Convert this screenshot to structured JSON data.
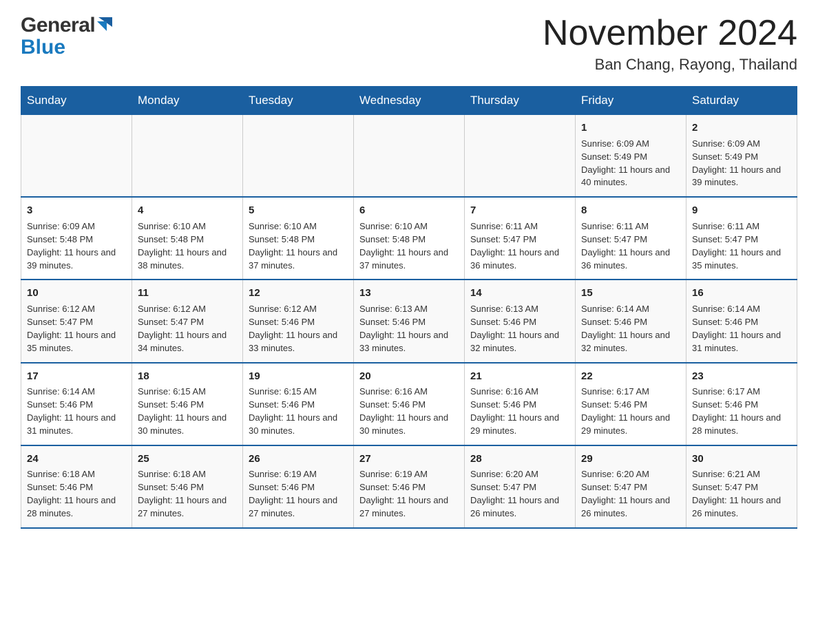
{
  "header": {
    "logo_general": "General",
    "logo_blue": "Blue",
    "title": "November 2024",
    "subtitle": "Ban Chang, Rayong, Thailand"
  },
  "days_of_week": [
    "Sunday",
    "Monday",
    "Tuesday",
    "Wednesday",
    "Thursday",
    "Friday",
    "Saturday"
  ],
  "weeks": [
    {
      "cells": [
        {
          "day": "",
          "info": ""
        },
        {
          "day": "",
          "info": ""
        },
        {
          "day": "",
          "info": ""
        },
        {
          "day": "",
          "info": ""
        },
        {
          "day": "",
          "info": ""
        },
        {
          "day": "1",
          "info": "Sunrise: 6:09 AM\nSunset: 5:49 PM\nDaylight: 11 hours and 40 minutes."
        },
        {
          "day": "2",
          "info": "Sunrise: 6:09 AM\nSunset: 5:49 PM\nDaylight: 11 hours and 39 minutes."
        }
      ]
    },
    {
      "cells": [
        {
          "day": "3",
          "info": "Sunrise: 6:09 AM\nSunset: 5:48 PM\nDaylight: 11 hours and 39 minutes."
        },
        {
          "day": "4",
          "info": "Sunrise: 6:10 AM\nSunset: 5:48 PM\nDaylight: 11 hours and 38 minutes."
        },
        {
          "day": "5",
          "info": "Sunrise: 6:10 AM\nSunset: 5:48 PM\nDaylight: 11 hours and 37 minutes."
        },
        {
          "day": "6",
          "info": "Sunrise: 6:10 AM\nSunset: 5:48 PM\nDaylight: 11 hours and 37 minutes."
        },
        {
          "day": "7",
          "info": "Sunrise: 6:11 AM\nSunset: 5:47 PM\nDaylight: 11 hours and 36 minutes."
        },
        {
          "day": "8",
          "info": "Sunrise: 6:11 AM\nSunset: 5:47 PM\nDaylight: 11 hours and 36 minutes."
        },
        {
          "day": "9",
          "info": "Sunrise: 6:11 AM\nSunset: 5:47 PM\nDaylight: 11 hours and 35 minutes."
        }
      ]
    },
    {
      "cells": [
        {
          "day": "10",
          "info": "Sunrise: 6:12 AM\nSunset: 5:47 PM\nDaylight: 11 hours and 35 minutes."
        },
        {
          "day": "11",
          "info": "Sunrise: 6:12 AM\nSunset: 5:47 PM\nDaylight: 11 hours and 34 minutes."
        },
        {
          "day": "12",
          "info": "Sunrise: 6:12 AM\nSunset: 5:46 PM\nDaylight: 11 hours and 33 minutes."
        },
        {
          "day": "13",
          "info": "Sunrise: 6:13 AM\nSunset: 5:46 PM\nDaylight: 11 hours and 33 minutes."
        },
        {
          "day": "14",
          "info": "Sunrise: 6:13 AM\nSunset: 5:46 PM\nDaylight: 11 hours and 32 minutes."
        },
        {
          "day": "15",
          "info": "Sunrise: 6:14 AM\nSunset: 5:46 PM\nDaylight: 11 hours and 32 minutes."
        },
        {
          "day": "16",
          "info": "Sunrise: 6:14 AM\nSunset: 5:46 PM\nDaylight: 11 hours and 31 minutes."
        }
      ]
    },
    {
      "cells": [
        {
          "day": "17",
          "info": "Sunrise: 6:14 AM\nSunset: 5:46 PM\nDaylight: 11 hours and 31 minutes."
        },
        {
          "day": "18",
          "info": "Sunrise: 6:15 AM\nSunset: 5:46 PM\nDaylight: 11 hours and 30 minutes."
        },
        {
          "day": "19",
          "info": "Sunrise: 6:15 AM\nSunset: 5:46 PM\nDaylight: 11 hours and 30 minutes."
        },
        {
          "day": "20",
          "info": "Sunrise: 6:16 AM\nSunset: 5:46 PM\nDaylight: 11 hours and 30 minutes."
        },
        {
          "day": "21",
          "info": "Sunrise: 6:16 AM\nSunset: 5:46 PM\nDaylight: 11 hours and 29 minutes."
        },
        {
          "day": "22",
          "info": "Sunrise: 6:17 AM\nSunset: 5:46 PM\nDaylight: 11 hours and 29 minutes."
        },
        {
          "day": "23",
          "info": "Sunrise: 6:17 AM\nSunset: 5:46 PM\nDaylight: 11 hours and 28 minutes."
        }
      ]
    },
    {
      "cells": [
        {
          "day": "24",
          "info": "Sunrise: 6:18 AM\nSunset: 5:46 PM\nDaylight: 11 hours and 28 minutes."
        },
        {
          "day": "25",
          "info": "Sunrise: 6:18 AM\nSunset: 5:46 PM\nDaylight: 11 hours and 27 minutes."
        },
        {
          "day": "26",
          "info": "Sunrise: 6:19 AM\nSunset: 5:46 PM\nDaylight: 11 hours and 27 minutes."
        },
        {
          "day": "27",
          "info": "Sunrise: 6:19 AM\nSunset: 5:46 PM\nDaylight: 11 hours and 27 minutes."
        },
        {
          "day": "28",
          "info": "Sunrise: 6:20 AM\nSunset: 5:47 PM\nDaylight: 11 hours and 26 minutes."
        },
        {
          "day": "29",
          "info": "Sunrise: 6:20 AM\nSunset: 5:47 PM\nDaylight: 11 hours and 26 minutes."
        },
        {
          "day": "30",
          "info": "Sunrise: 6:21 AM\nSunset: 5:47 PM\nDaylight: 11 hours and 26 minutes."
        }
      ]
    }
  ]
}
